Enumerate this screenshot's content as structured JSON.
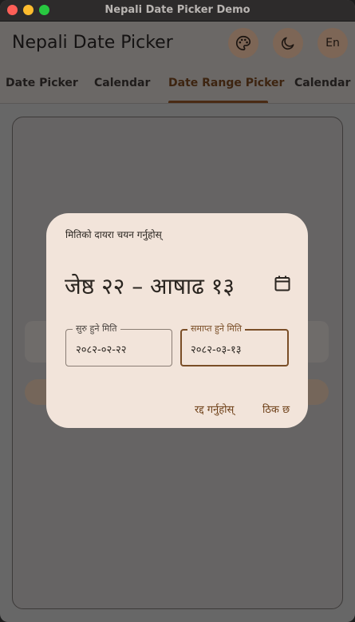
{
  "window": {
    "title": "Nepali Date Picker Demo"
  },
  "appbar": {
    "title": "Nepali Date Picker",
    "theme_icon": "palette-icon",
    "mode_icon": "moon-icon",
    "language_label": "En"
  },
  "tabs": [
    {
      "label": "Date Picker"
    },
    {
      "label": "Calendar"
    },
    {
      "label": "Date Range Picker"
    },
    {
      "label": "Calendar R"
    }
  ],
  "active_tab": "Date Range Picker",
  "dialog": {
    "help_text": "मितिको दायरा चयन गर्नुहोस्",
    "range_text": "जेष्ठ २२ – आषाढ १३",
    "calendar_icon": "calendar-icon",
    "start_field": {
      "label": "सुरु हुने मिति",
      "value": "२०८२-०२-२२"
    },
    "end_field": {
      "label": "समाप्त हुने मिति",
      "value": "२०८२-०३-१३"
    },
    "cancel_label": "रद्द गर्नुहोस्",
    "ok_label": "ठिक छ"
  },
  "colors": {
    "accent": "#7a4e27",
    "dialog_bg": "#f2e4da",
    "scrim": "#676767"
  }
}
